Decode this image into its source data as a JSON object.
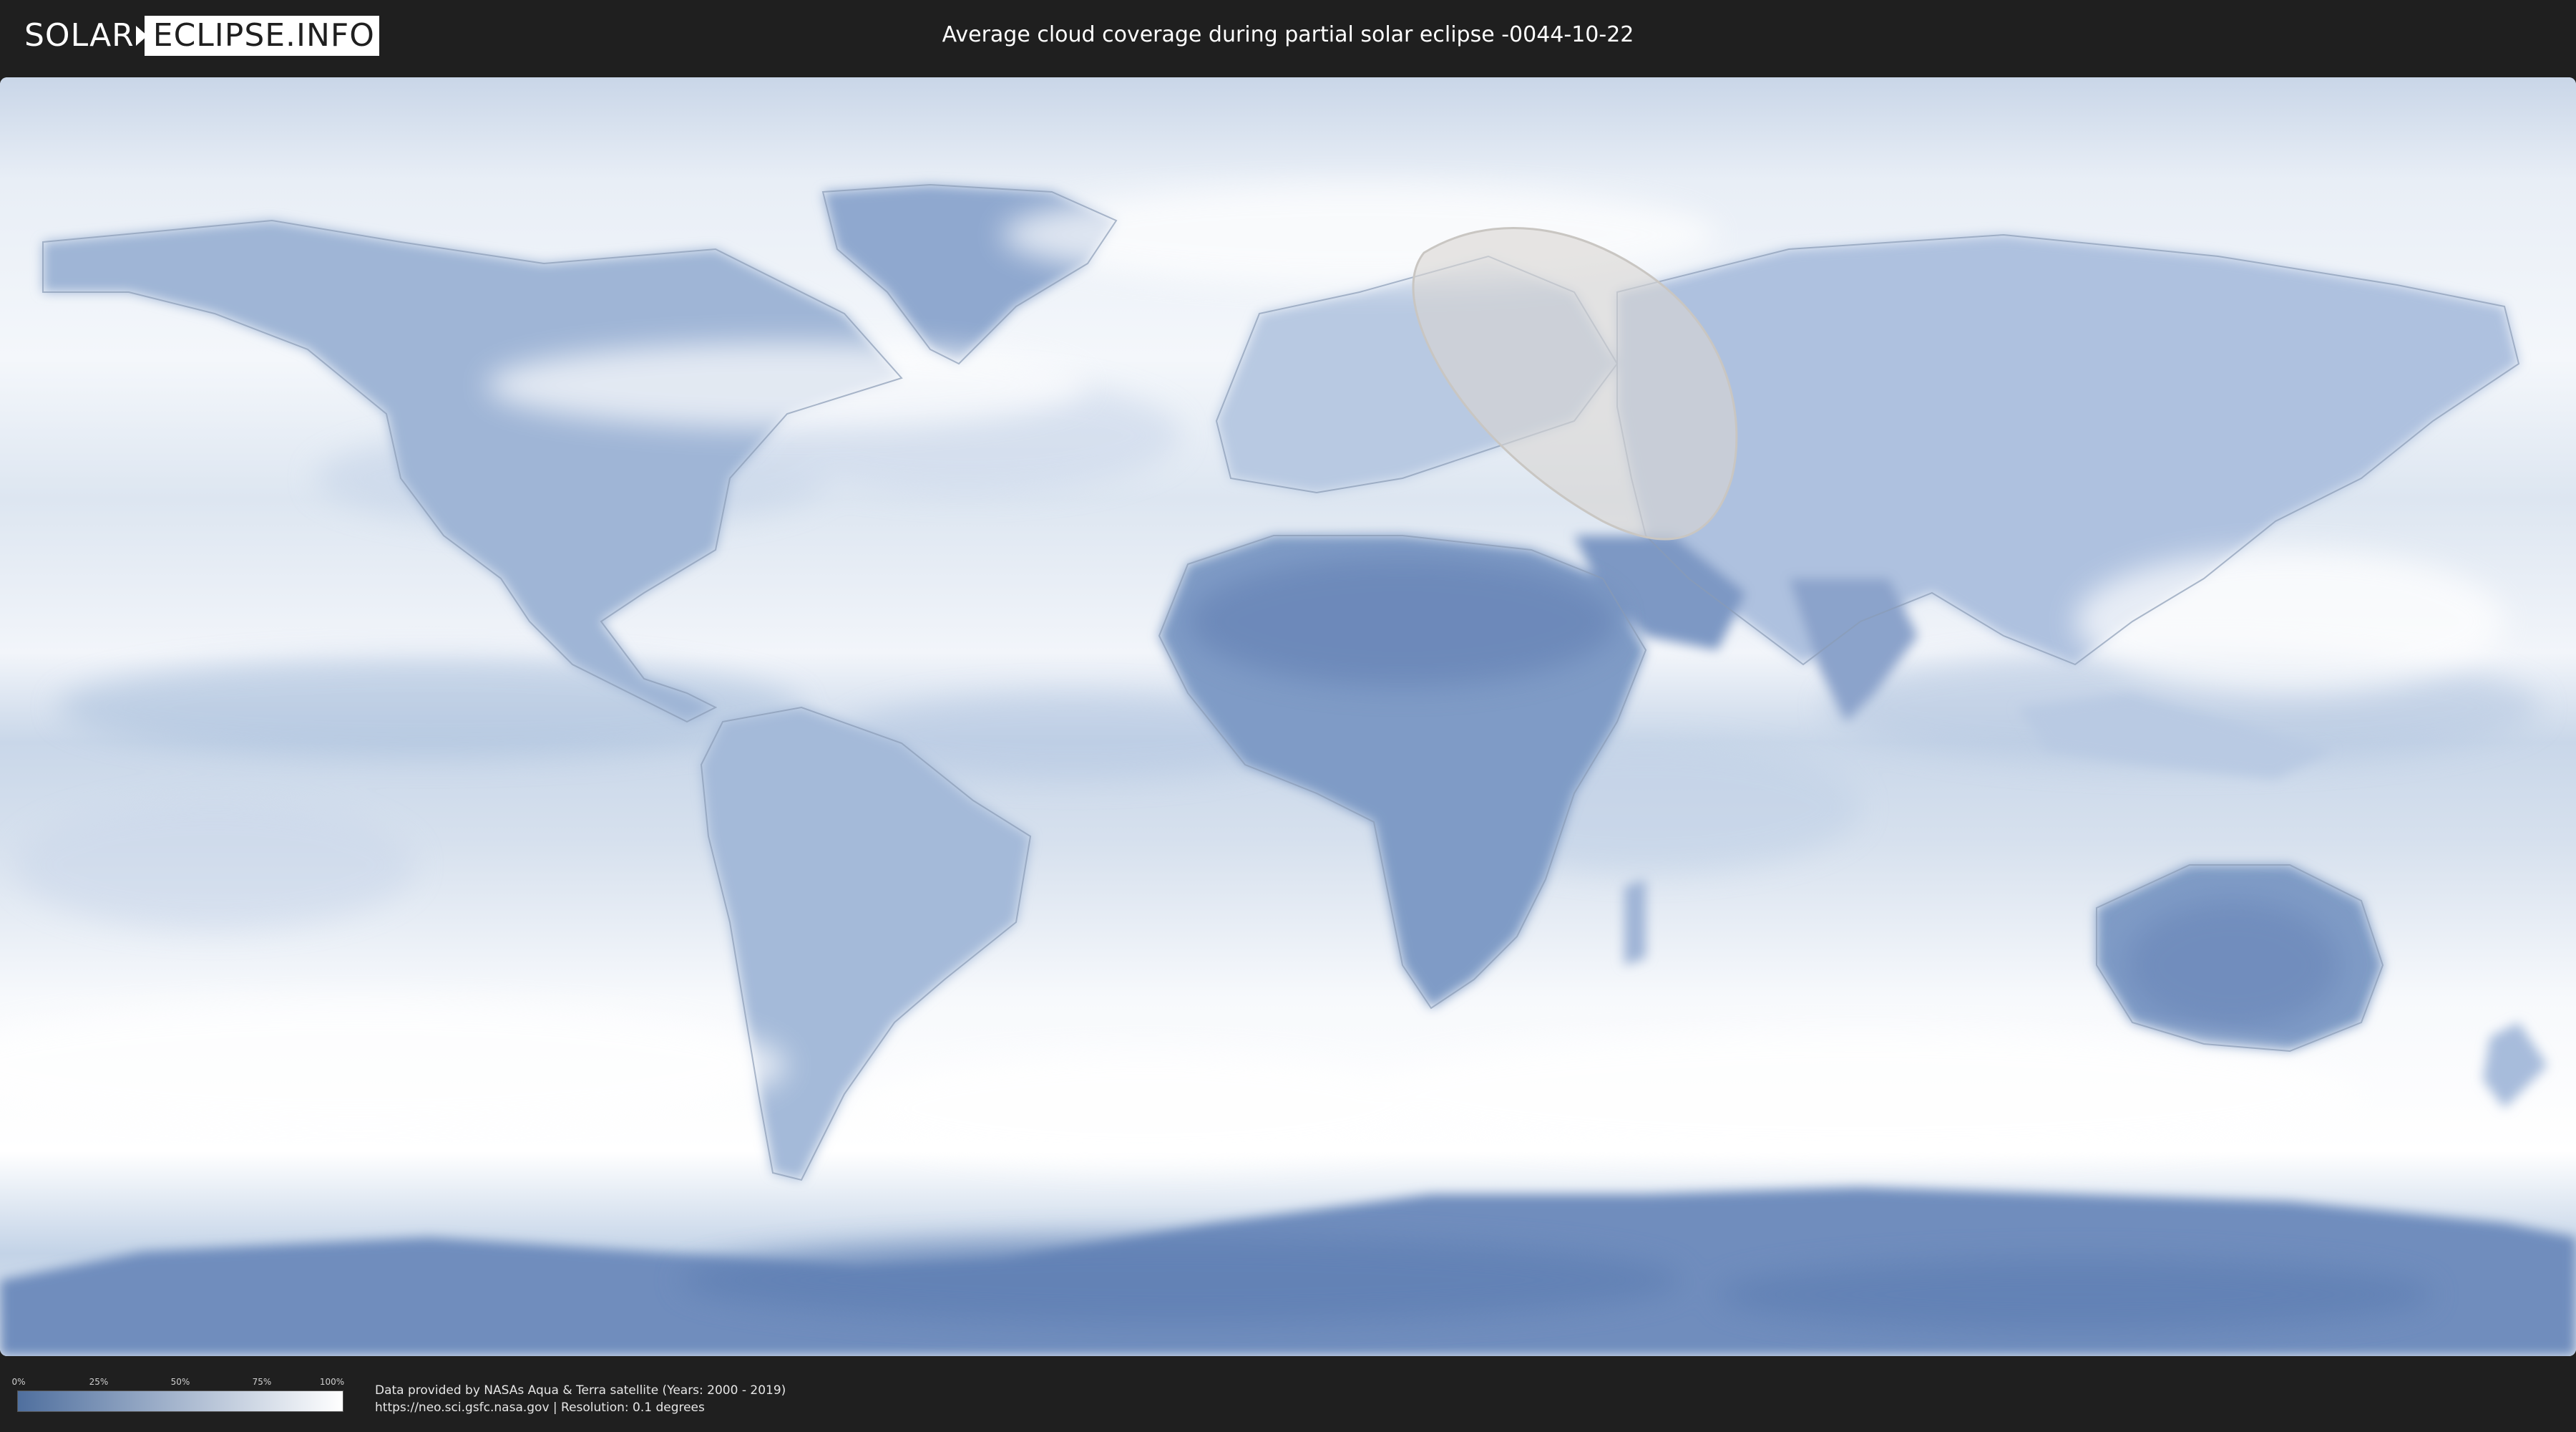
{
  "header": {
    "logo": {
      "part1": "SOLAR",
      "part2": "ECLIPSE.INFO"
    },
    "title": "Average cloud coverage during partial solar eclipse -0044-10-22"
  },
  "map": {
    "type": "world-cloud-coverage",
    "projection": "equirectangular",
    "layers": [
      "cloud-coverage",
      "country-borders",
      "eclipse-visibility-area"
    ],
    "colors": {
      "clear": "#4f6f9e",
      "cloudy": "#ffffff",
      "eclipse_area": "#d9d6d2"
    }
  },
  "legend": {
    "ticks": [
      "0%",
      "25%",
      "50%",
      "75%",
      "100%"
    ],
    "gradient_from": "#4f6f9e",
    "gradient_to": "#ffffff"
  },
  "footer": {
    "source_line": "Data provided by NASAs Aqua & Terra satellite (Years: 2000 - 2019)",
    "url_line": "https://neo.sci.gsfc.nasa.gov | Resolution: 0.1 degrees"
  }
}
